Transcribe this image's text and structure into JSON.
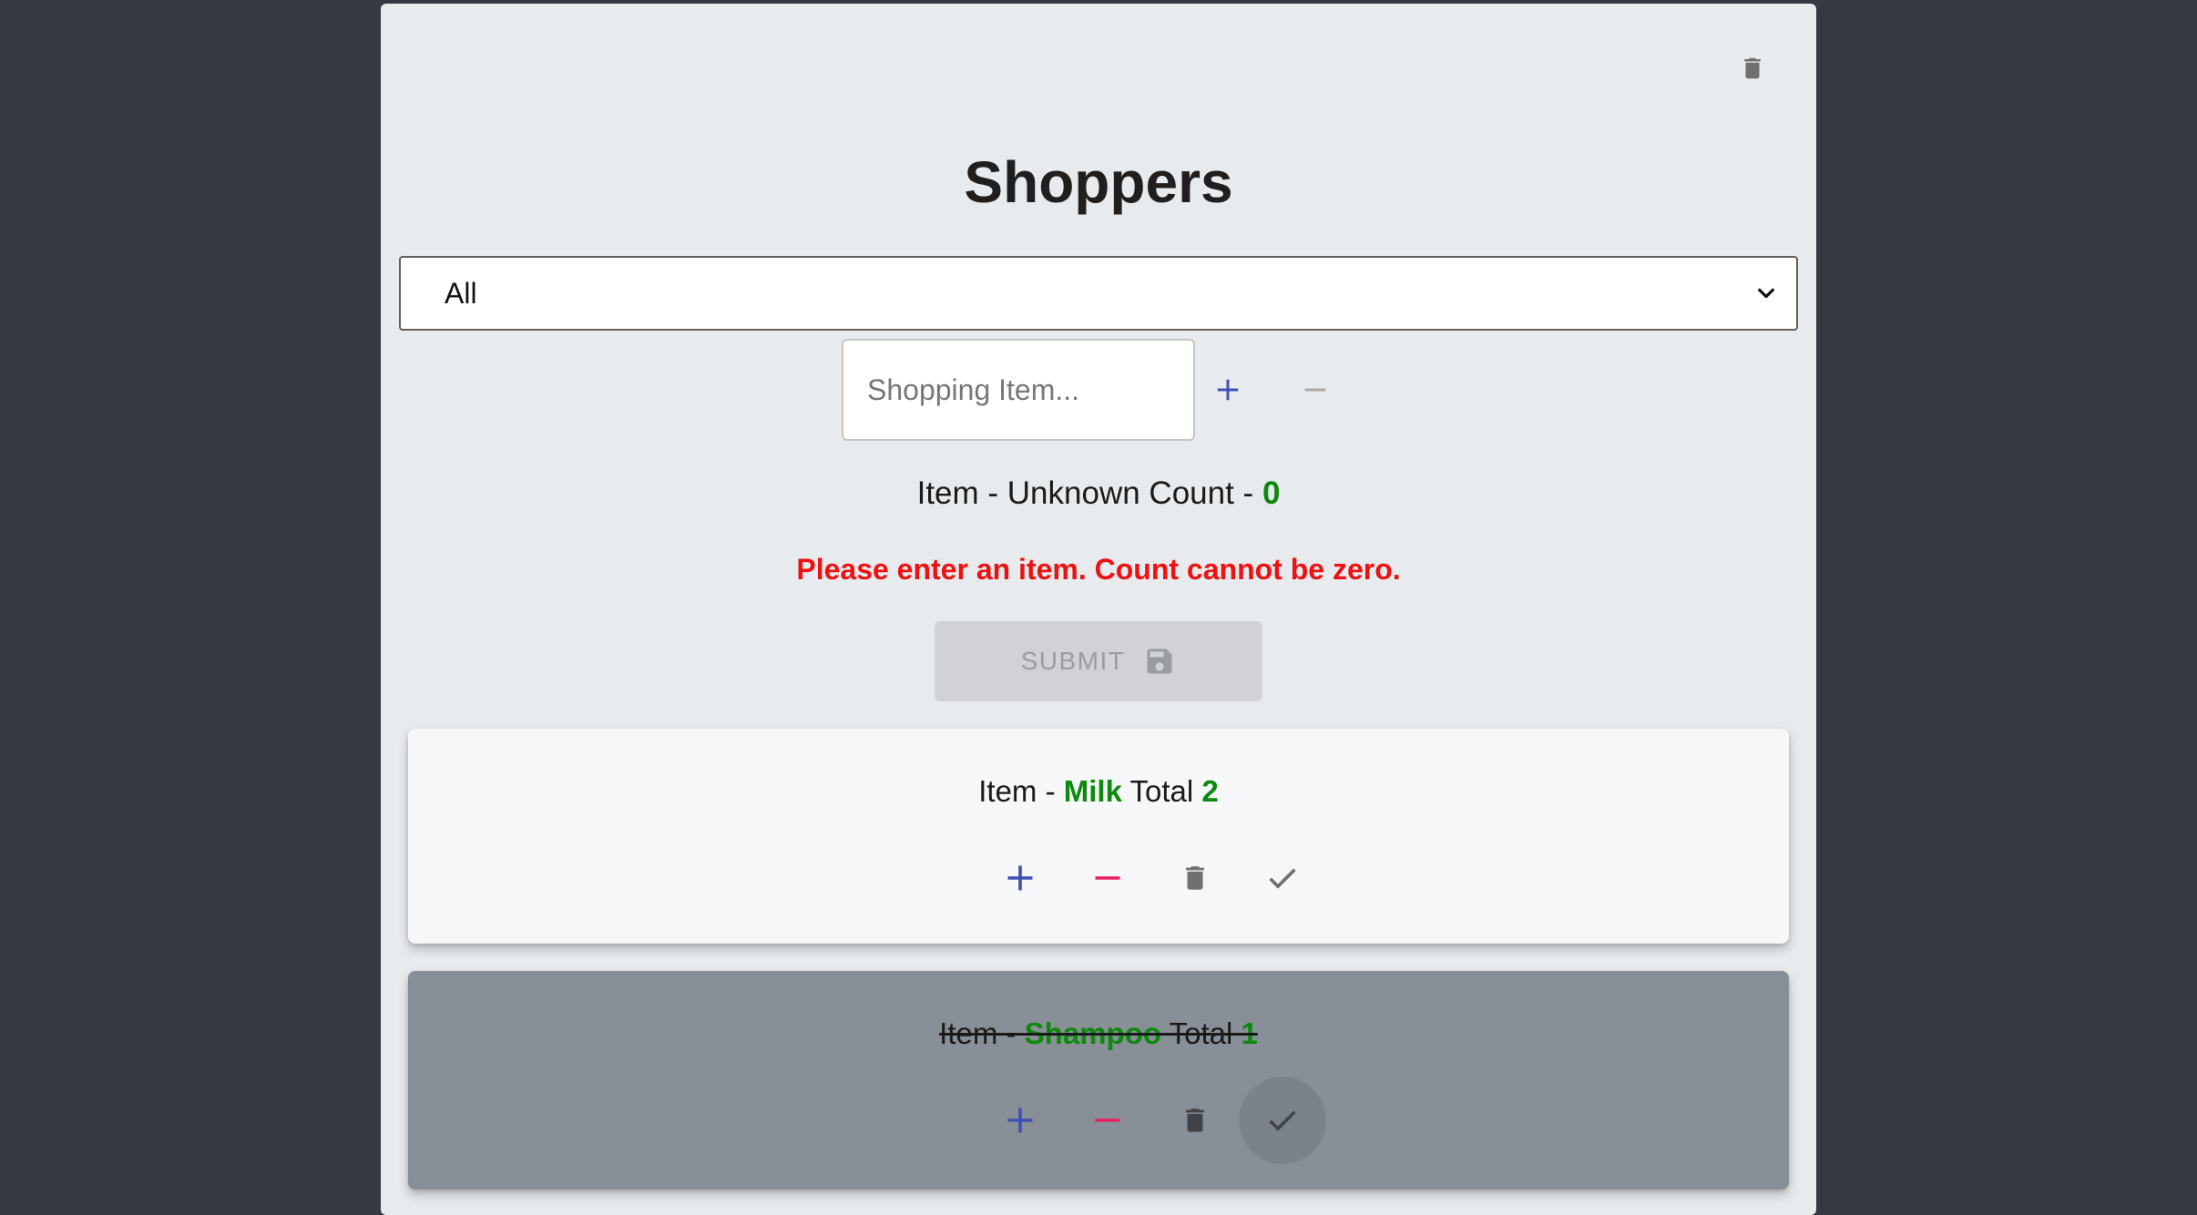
{
  "app": {
    "title": "Shoppers"
  },
  "filter": {
    "selected": "All"
  },
  "input": {
    "placeholder": "Shopping Item..."
  },
  "summary": {
    "prefix": "Item - ",
    "item": "Unknown",
    "count_label": " Count - ",
    "count": "0"
  },
  "error_message": "Please enter an item. Count cannot be zero.",
  "submit": {
    "label": "SUBMIT"
  },
  "items": [
    {
      "prefix": "Item - ",
      "name": "Milk",
      "total_label": " Total ",
      "total": "2",
      "completed": false
    },
    {
      "prefix": "Item - ",
      "name": "Shampoo",
      "total_label": " Total ",
      "total": "1",
      "completed": true
    }
  ],
  "icons": {
    "delete_all": "trash-icon",
    "increment": "plus-icon",
    "decrement": "minus-icon",
    "select_arrow": "chevron-down-icon",
    "save": "floppy-disk-icon",
    "complete": "check-icon"
  },
  "colors": {
    "background": "#363b42",
    "panel": "#e8ebee",
    "accent_blue": "#3f51b5",
    "accent_pink": "#e91e63",
    "value_green": "#0c8a0c",
    "error_red": "#ee1111",
    "completed_card": "#888f97"
  }
}
